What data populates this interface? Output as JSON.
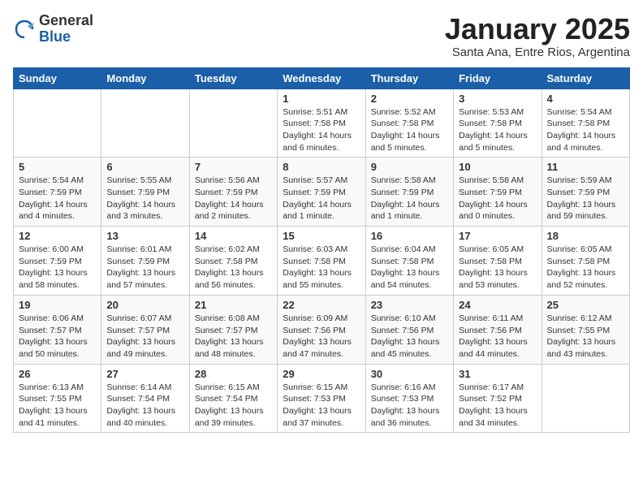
{
  "header": {
    "logo_general": "General",
    "logo_blue": "Blue",
    "title": "January 2025",
    "subtitle": "Santa Ana, Entre Rios, Argentina"
  },
  "days_of_week": [
    "Sunday",
    "Monday",
    "Tuesday",
    "Wednesday",
    "Thursday",
    "Friday",
    "Saturday"
  ],
  "weeks": [
    [
      {
        "day": "",
        "info": ""
      },
      {
        "day": "",
        "info": ""
      },
      {
        "day": "",
        "info": ""
      },
      {
        "day": "1",
        "info": "Sunrise: 5:51 AM\nSunset: 7:58 PM\nDaylight: 14 hours\nand 6 minutes."
      },
      {
        "day": "2",
        "info": "Sunrise: 5:52 AM\nSunset: 7:58 PM\nDaylight: 14 hours\nand 5 minutes."
      },
      {
        "day": "3",
        "info": "Sunrise: 5:53 AM\nSunset: 7:58 PM\nDaylight: 14 hours\nand 5 minutes."
      },
      {
        "day": "4",
        "info": "Sunrise: 5:54 AM\nSunset: 7:58 PM\nDaylight: 14 hours\nand 4 minutes."
      }
    ],
    [
      {
        "day": "5",
        "info": "Sunrise: 5:54 AM\nSunset: 7:59 PM\nDaylight: 14 hours\nand 4 minutes."
      },
      {
        "day": "6",
        "info": "Sunrise: 5:55 AM\nSunset: 7:59 PM\nDaylight: 14 hours\nand 3 minutes."
      },
      {
        "day": "7",
        "info": "Sunrise: 5:56 AM\nSunset: 7:59 PM\nDaylight: 14 hours\nand 2 minutes."
      },
      {
        "day": "8",
        "info": "Sunrise: 5:57 AM\nSunset: 7:59 PM\nDaylight: 14 hours\nand 1 minute."
      },
      {
        "day": "9",
        "info": "Sunrise: 5:58 AM\nSunset: 7:59 PM\nDaylight: 14 hours\nand 1 minute."
      },
      {
        "day": "10",
        "info": "Sunrise: 5:58 AM\nSunset: 7:59 PM\nDaylight: 14 hours\nand 0 minutes."
      },
      {
        "day": "11",
        "info": "Sunrise: 5:59 AM\nSunset: 7:59 PM\nDaylight: 13 hours\nand 59 minutes."
      }
    ],
    [
      {
        "day": "12",
        "info": "Sunrise: 6:00 AM\nSunset: 7:59 PM\nDaylight: 13 hours\nand 58 minutes."
      },
      {
        "day": "13",
        "info": "Sunrise: 6:01 AM\nSunset: 7:59 PM\nDaylight: 13 hours\nand 57 minutes."
      },
      {
        "day": "14",
        "info": "Sunrise: 6:02 AM\nSunset: 7:58 PM\nDaylight: 13 hours\nand 56 minutes."
      },
      {
        "day": "15",
        "info": "Sunrise: 6:03 AM\nSunset: 7:58 PM\nDaylight: 13 hours\nand 55 minutes."
      },
      {
        "day": "16",
        "info": "Sunrise: 6:04 AM\nSunset: 7:58 PM\nDaylight: 13 hours\nand 54 minutes."
      },
      {
        "day": "17",
        "info": "Sunrise: 6:05 AM\nSunset: 7:58 PM\nDaylight: 13 hours\nand 53 minutes."
      },
      {
        "day": "18",
        "info": "Sunrise: 6:05 AM\nSunset: 7:58 PM\nDaylight: 13 hours\nand 52 minutes."
      }
    ],
    [
      {
        "day": "19",
        "info": "Sunrise: 6:06 AM\nSunset: 7:57 PM\nDaylight: 13 hours\nand 50 minutes."
      },
      {
        "day": "20",
        "info": "Sunrise: 6:07 AM\nSunset: 7:57 PM\nDaylight: 13 hours\nand 49 minutes."
      },
      {
        "day": "21",
        "info": "Sunrise: 6:08 AM\nSunset: 7:57 PM\nDaylight: 13 hours\nand 48 minutes."
      },
      {
        "day": "22",
        "info": "Sunrise: 6:09 AM\nSunset: 7:56 PM\nDaylight: 13 hours\nand 47 minutes."
      },
      {
        "day": "23",
        "info": "Sunrise: 6:10 AM\nSunset: 7:56 PM\nDaylight: 13 hours\nand 45 minutes."
      },
      {
        "day": "24",
        "info": "Sunrise: 6:11 AM\nSunset: 7:56 PM\nDaylight: 13 hours\nand 44 minutes."
      },
      {
        "day": "25",
        "info": "Sunrise: 6:12 AM\nSunset: 7:55 PM\nDaylight: 13 hours\nand 43 minutes."
      }
    ],
    [
      {
        "day": "26",
        "info": "Sunrise: 6:13 AM\nSunset: 7:55 PM\nDaylight: 13 hours\nand 41 minutes."
      },
      {
        "day": "27",
        "info": "Sunrise: 6:14 AM\nSunset: 7:54 PM\nDaylight: 13 hours\nand 40 minutes."
      },
      {
        "day": "28",
        "info": "Sunrise: 6:15 AM\nSunset: 7:54 PM\nDaylight: 13 hours\nand 39 minutes."
      },
      {
        "day": "29",
        "info": "Sunrise: 6:15 AM\nSunset: 7:53 PM\nDaylight: 13 hours\nand 37 minutes."
      },
      {
        "day": "30",
        "info": "Sunrise: 6:16 AM\nSunset: 7:53 PM\nDaylight: 13 hours\nand 36 minutes."
      },
      {
        "day": "31",
        "info": "Sunrise: 6:17 AM\nSunset: 7:52 PM\nDaylight: 13 hours\nand 34 minutes."
      },
      {
        "day": "",
        "info": ""
      }
    ]
  ]
}
